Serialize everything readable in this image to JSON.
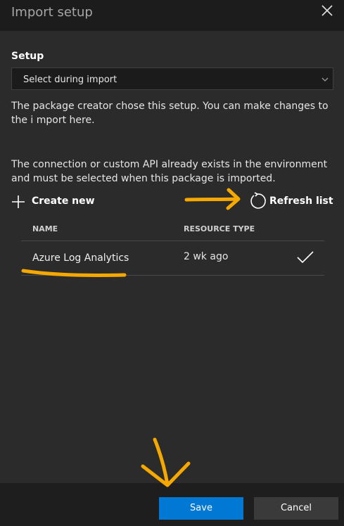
{
  "header": {
    "title": "Import setup",
    "close_icon": "close-icon"
  },
  "setup": {
    "label": "Setup",
    "selected_option": "Select during import",
    "info_text": "The package creator chose this setup. You can make changes to the i mport here."
  },
  "connection": {
    "info_text": "The connection or custom API already exists in the environment and must be selected when this package is imported.",
    "create_new_label": "Create new",
    "refresh_label": "Refresh list"
  },
  "table": {
    "columns": [
      "NAME",
      "RESOURCE TYPE"
    ],
    "rows": [
      {
        "name": "Azure Log Analytics",
        "resource_type": "2 wk ago",
        "selected": true
      }
    ]
  },
  "footer": {
    "save_label": "Save",
    "cancel_label": "Cancel"
  },
  "colors": {
    "accent": "#0078d4",
    "annotation": "#f5a800",
    "background": "#2b2b2b"
  }
}
